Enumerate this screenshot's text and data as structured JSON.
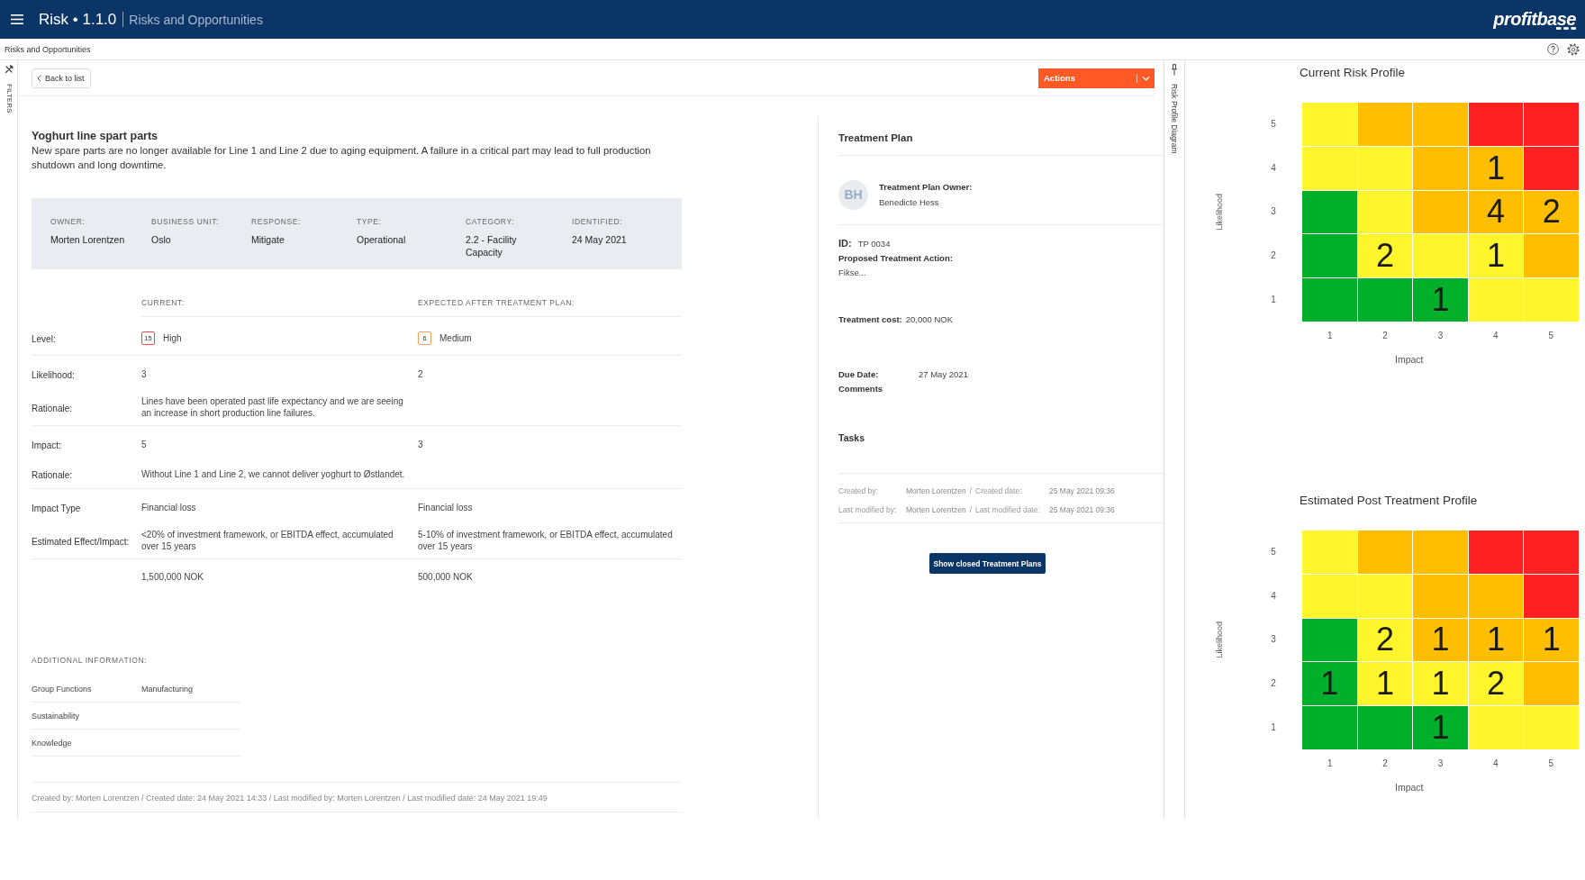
{
  "header": {
    "title": "Risk • 1.1.0",
    "subtitle": "Risks and Opportunities",
    "logo": "profitbase"
  },
  "breadcrumb": "Risks and Opportunities",
  "filters_tab": "FILTERS",
  "toolbar": {
    "back_button": "Back to list",
    "actions_button": "Actions"
  },
  "risk": {
    "title": "Yoghurt line spart parts",
    "description": "New spare parts are no longer available for Line 1 and Line 2 due to aging equipment. A failure in a critical part may lead to full production shutdown and long downtime.",
    "fields": [
      {
        "label": "OWNER:",
        "value": "Morten Lorentzen"
      },
      {
        "label": "BUSINESS UNIT:",
        "value": "Oslo"
      },
      {
        "label": "RESPONSE:",
        "value": "Mitigate"
      },
      {
        "label": "TYPE:",
        "value": "Operational"
      },
      {
        "label": "CATEGORY:",
        "value": "2.2 - Facility Capacity"
      },
      {
        "label": "IDENTIFIED:",
        "value": "24 May 2021"
      }
    ]
  },
  "assessment": {
    "columns": [
      "CURRENT:",
      "EXPECTED AFTER TREATMENT PLAN:"
    ],
    "groups": [
      {
        "rows": [
          {
            "kind": "level",
            "label": "Level:",
            "current": {
              "score": "15",
              "text": "High",
              "color": "#e8474b"
            },
            "expected": {
              "score": "6",
              "text": "Medium",
              "color": "#f3a35f"
            }
          }
        ]
      },
      {
        "rows": [
          {
            "kind": "text",
            "label": "Likelihood:",
            "current": "3",
            "expected": "2"
          },
          {
            "kind": "text",
            "label": "Rationale:",
            "current": "Lines have been operated past life expectancy and we are seeing an increase in short production line failures."
          }
        ]
      },
      {
        "rows": [
          {
            "kind": "text",
            "label": "Impact:",
            "current": "5",
            "expected": "3"
          },
          {
            "kind": "text",
            "label": "Rationale:",
            "current": "Without Line 1 and Line 2, we cannot deliver yoghurt to Østlandet."
          }
        ]
      },
      {
        "rows": [
          {
            "kind": "text",
            "label": "Impact Type",
            "current": "Financial loss",
            "expected": "Financial loss"
          },
          {
            "kind": "text",
            "label": "Estimated Effect/Impact:",
            "current": "<20% of investment framework, or EBITDA effect, accumulated over 15 years",
            "expected": "5-10% of investment framework, or EBITDA effect, accumulated over 15 years"
          }
        ]
      },
      {
        "rows": [
          {
            "kind": "text",
            "current": "1,500,000 NOK",
            "expected": "500,000 NOK"
          }
        ]
      }
    ]
  },
  "additional_info": {
    "heading": "ADDITIONAL INFORMATION:",
    "items": [
      {
        "label": "Group Functions",
        "value": "Manufacturing"
      },
      {
        "label": "Sustainability"
      },
      {
        "label": "Knowledge"
      }
    ]
  },
  "record_footer": "Created by: Morten Lorentzen / Created date: 24 May 2021 14:33 / Last modified by: Morten Lorentzen / Last modified date: 24 May 2021 19:49",
  "treatment_plan": {
    "title": "Treatment Plan",
    "owner": {
      "initials": "BH",
      "label": "Treatment Plan Owner:",
      "name": "Benedicte Hess"
    },
    "id": {
      "label": "ID:",
      "value": "TP 0034"
    },
    "action": {
      "label": "Proposed Treatment Action:",
      "value": "Fikse..."
    },
    "cost": {
      "label": "Treatment cost:",
      "value": "20,000 NOK"
    },
    "due_date": {
      "label": "Due Date:",
      "value": "27 May 2021"
    },
    "comments": "Comments",
    "tasks": "Tasks",
    "audit": [
      {
        "by_label": "Created by:",
        "by": "Morten Lorentzen",
        "separator": "/",
        "date_label": "Created date:",
        "date": "25 May 2021 09:36"
      },
      {
        "by_label": "Last modified by:",
        "by": "Morten Lorentzen",
        "separator": "/",
        "date_label": "Last modified date:",
        "date": "25 May 2021 09:36"
      }
    ],
    "closed_button": "Show closed Treatment Plans"
  },
  "diagram_tab": "Risk Profile Diagram",
  "risk_profiles": [
    {
      "title": "Current Risk Profile",
      "ylabel": "Likelihood",
      "xlabel": "Impact",
      "yticks": [
        "5",
        "4",
        "3",
        "2",
        "1"
      ],
      "xticks": [
        "1",
        "2",
        "3",
        "4",
        "5"
      ],
      "rows": [
        {
          "cells": [
            {
              "color": "#fff52d"
            },
            {
              "color": "#ffbf00"
            },
            {
              "color": "#ffbf00"
            },
            {
              "color": "#ff2121"
            },
            {
              "color": "#ff2121"
            }
          ]
        },
        {
          "cells": [
            {
              "color": "#fff52d"
            },
            {
              "color": "#fff52d"
            },
            {
              "color": "#ffbf00"
            },
            {
              "color": "#ffbf00",
              "count": "1"
            },
            {
              "color": "#ff2121"
            }
          ]
        },
        {
          "cells": [
            {
              "color": "#00b02a"
            },
            {
              "color": "#fff52d"
            },
            {
              "color": "#ffbf00"
            },
            {
              "color": "#ffbf00",
              "count": "4"
            },
            {
              "color": "#ffbf00",
              "count": "2"
            }
          ]
        },
        {
          "cells": [
            {
              "color": "#00b02a"
            },
            {
              "color": "#fff52d",
              "count": "2"
            },
            {
              "color": "#fff52d"
            },
            {
              "color": "#fff52d",
              "count": "1"
            },
            {
              "color": "#ffbf00"
            }
          ]
        },
        {
          "cells": [
            {
              "color": "#00b02a"
            },
            {
              "color": "#00b02a"
            },
            {
              "color": "#00b02a",
              "count": "1"
            },
            {
              "color": "#fff52d"
            },
            {
              "color": "#fff52d"
            }
          ]
        }
      ]
    },
    {
      "title": "Estimated Post Treatment Profile",
      "ylabel": "Likelihood",
      "xlabel": "Impact",
      "yticks": [
        "5",
        "4",
        "3",
        "2",
        "1"
      ],
      "xticks": [
        "1",
        "2",
        "3",
        "4",
        "5"
      ],
      "rows": [
        {
          "cells": [
            {
              "color": "#fff52d"
            },
            {
              "color": "#ffbf00"
            },
            {
              "color": "#ffbf00"
            },
            {
              "color": "#ff2121"
            },
            {
              "color": "#ff2121"
            }
          ]
        },
        {
          "cells": [
            {
              "color": "#fff52d"
            },
            {
              "color": "#fff52d"
            },
            {
              "color": "#ffbf00"
            },
            {
              "color": "#ffbf00"
            },
            {
              "color": "#ff2121"
            }
          ]
        },
        {
          "cells": [
            {
              "color": "#00b02a"
            },
            {
              "color": "#fff52d",
              "count": "2"
            },
            {
              "color": "#ffbf00",
              "count": "1"
            },
            {
              "color": "#ffbf00",
              "count": "1"
            },
            {
              "color": "#ffbf00",
              "count": "1"
            }
          ]
        },
        {
          "cells": [
            {
              "color": "#00b02a",
              "count": "1"
            },
            {
              "color": "#fff52d",
              "count": "1"
            },
            {
              "color": "#fff52d",
              "count": "1"
            },
            {
              "color": "#fff52d",
              "count": "2"
            },
            {
              "color": "#ffbf00"
            }
          ]
        },
        {
          "cells": [
            {
              "color": "#00b02a"
            },
            {
              "color": "#00b02a"
            },
            {
              "color": "#00b02a",
              "count": "1"
            },
            {
              "color": "#fff52d"
            },
            {
              "color": "#fff52d"
            }
          ]
        }
      ]
    }
  ]
}
